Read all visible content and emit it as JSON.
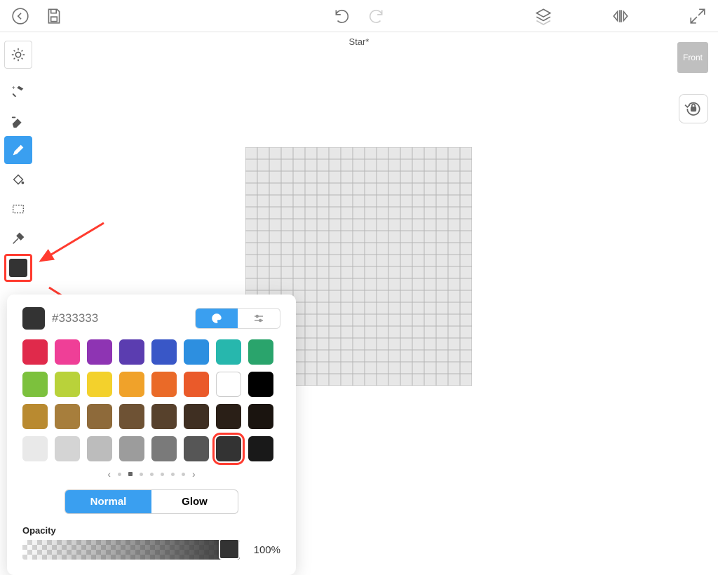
{
  "document": {
    "title": "Star*"
  },
  "front_badge": "Front",
  "color_picker": {
    "hex": "#333333",
    "mode_labels": {
      "normal": "Normal",
      "glow": "Glow"
    },
    "opacity_label": "Opacity",
    "opacity_value": "100%",
    "swatches": [
      [
        "#e02a4b",
        "#ef3f97",
        "#8e34b3",
        "#5b3db0",
        "#3957c7",
        "#2d8fe0",
        "#27b7ad",
        "#2aa46c"
      ],
      [
        "#7cc13d",
        "#b9d23a",
        "#f3d12c",
        "#f0a22a",
        "#ea6a28",
        "#ea5a2a",
        "#ffffff",
        "#000000"
      ],
      [
        "#b98a30",
        "#a77e3c",
        "#8e6a3a",
        "#6e5234",
        "#57412c",
        "#3f2f22",
        "#2a1f17",
        "#1a140f"
      ],
      [
        "#e9e9e9",
        "#d4d4d4",
        "#bcbcbc",
        "#9c9c9c",
        "#7a7a7a",
        "#565656",
        "#333333",
        "#191919"
      ]
    ],
    "selected_row": 3,
    "selected_col": 6,
    "pager_pages": 7,
    "pager_active": 1
  }
}
